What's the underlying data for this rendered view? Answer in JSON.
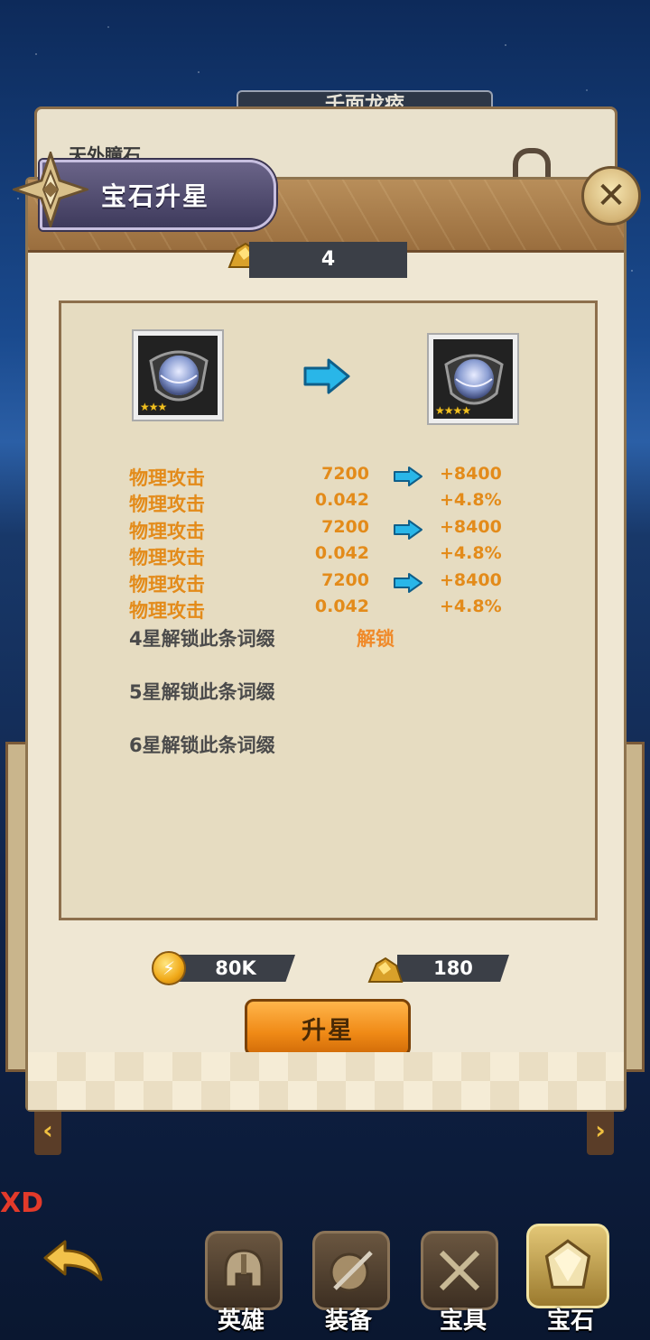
{
  "background_panel": {
    "tab_title": "千面龙瘁",
    "item_title": "天外瞳石"
  },
  "dialog": {
    "title": "宝石升星",
    "close_icon": "close-icon",
    "material_count": "4"
  },
  "gem": {
    "current_stars": "★★★",
    "next_stars": "★★★★"
  },
  "stats": [
    {
      "name": "物理攻击",
      "old": "7200",
      "new": "+8400",
      "arrow": true
    },
    {
      "name": "物理攻击",
      "old": "0.042",
      "new": "+4.8%",
      "arrow": false
    },
    {
      "name": "物理攻击",
      "old": "7200",
      "new": "+8400",
      "arrow": true
    },
    {
      "name": "物理攻击",
      "old": "0.042",
      "new": "+4.8%",
      "arrow": false
    },
    {
      "name": "物理攻击",
      "old": "7200",
      "new": "+8400",
      "arrow": true
    },
    {
      "name": "物理攻击",
      "old": "0.042",
      "new": "+4.8%",
      "arrow": false
    }
  ],
  "locked_affixes": [
    {
      "label": "4星解锁此条词缀"
    },
    {
      "label": "5星解锁此条词缀"
    },
    {
      "label": "6星解锁此条词缀"
    }
  ],
  "unlock_tag": "解锁",
  "cost": {
    "gold": "80K",
    "ore": "180"
  },
  "upgrade_button": "升星",
  "side_text": "XD",
  "bottom_tabs": [
    {
      "label": "英雄",
      "icon": "helmet-icon"
    },
    {
      "label": "装备",
      "icon": "shield-sword-icon"
    },
    {
      "label": "宝具",
      "icon": "crossed-swords-icon"
    },
    {
      "label": "宝石",
      "icon": "gem-icon",
      "active": true
    }
  ],
  "colors": {
    "stat_orange": "#e38b1a",
    "unlock_orange": "#f08a2a",
    "arrow_cyan": "#29b6e8",
    "button_orange": "#f08a16"
  }
}
